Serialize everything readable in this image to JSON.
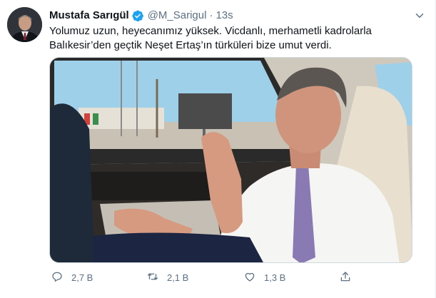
{
  "tweet": {
    "display_name": "Mustafa Sarıgül",
    "handle": "@M_Sarigul",
    "separator": "·",
    "time": "13s",
    "text_line1": "Yolumuz uzun, heyecanımız yüksek. Vicdanlı, merhametli kadrolarla",
    "text_line2": "Balıkesir’den geçtik Neşet Ertaş’ın türküleri bize umut verdi."
  },
  "actions": {
    "reply": {
      "icon": "reply-icon",
      "count": "2,7 B"
    },
    "retweet": {
      "icon": "retweet-icon",
      "count": "2,1 B"
    },
    "like": {
      "icon": "like-icon",
      "count": "1,3 B"
    },
    "share": {
      "icon": "share-icon"
    }
  },
  "colors": {
    "text_primary": "#0f1419",
    "text_secondary": "#5b7083",
    "verified_blue": "#1da1f2"
  }
}
